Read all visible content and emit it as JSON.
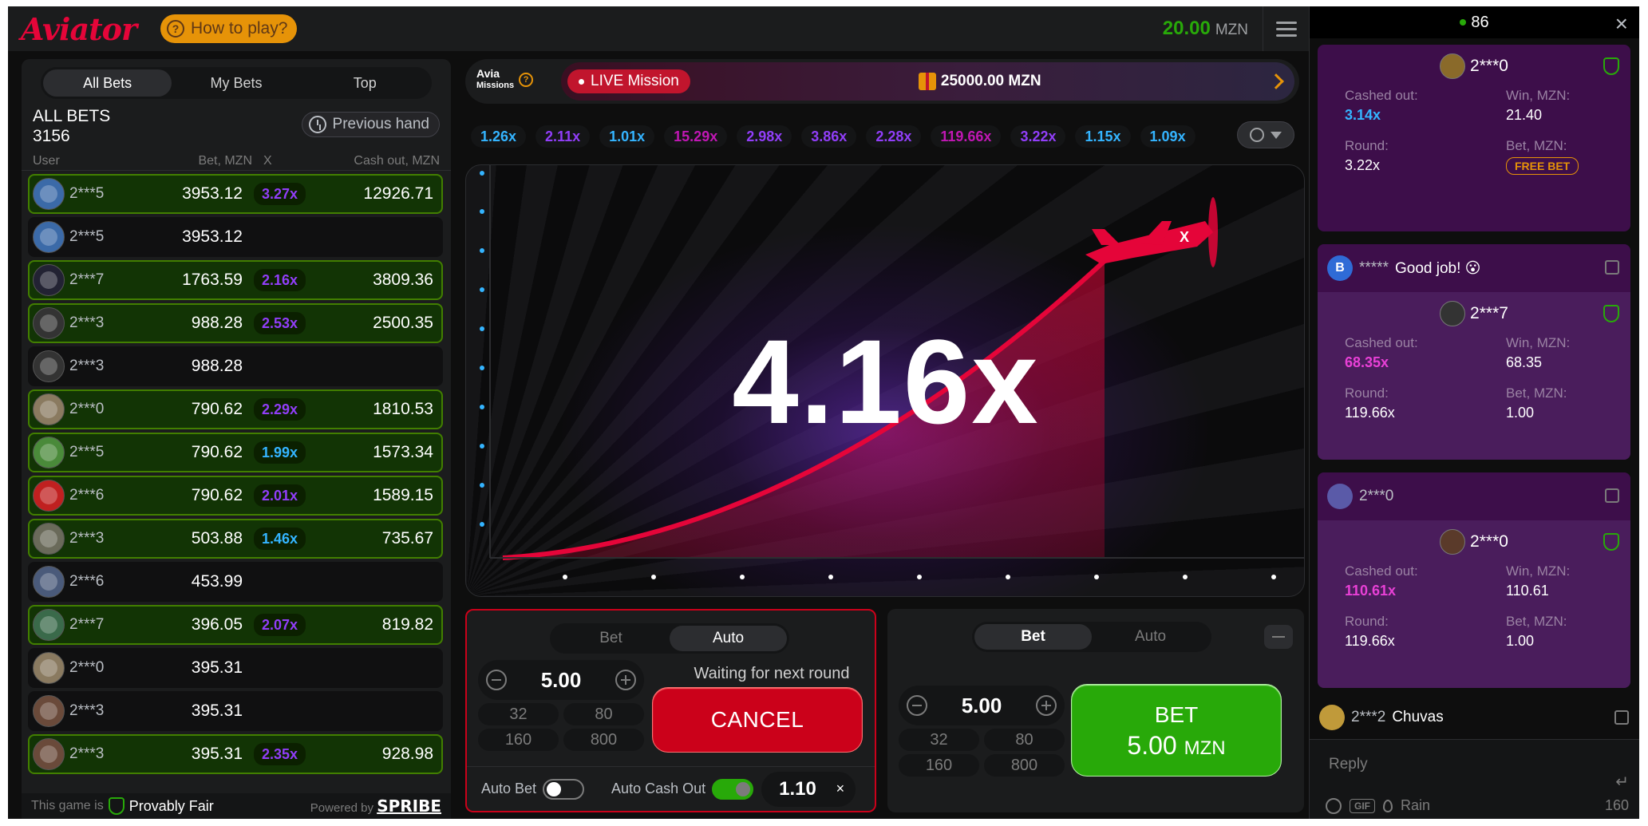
{
  "header": {
    "logo": "Aviator",
    "how_to_play": "How to play?",
    "balance": "20.00",
    "currency": "MZN"
  },
  "bets_panel": {
    "tabs": [
      "All Bets",
      "My Bets",
      "Top"
    ],
    "active_tab": "All Bets",
    "title": "ALL BETS",
    "count": "3156",
    "previous_hand": "Previous hand",
    "columns": {
      "user": "User",
      "bet": "Bet, MZN",
      "x": "X",
      "cashout": "Cash out, MZN"
    },
    "rows": [
      {
        "user": "2***5",
        "bet": "3953.12",
        "mult": "3.27x",
        "cashout": "12926.71",
        "win": true,
        "mult_color": "#913ef8",
        "avatar": "#3b6aa8"
      },
      {
        "user": "2***5",
        "bet": "3953.12",
        "mult": "",
        "cashout": "",
        "win": false,
        "mult_color": "",
        "avatar": "#3b6aa8"
      },
      {
        "user": "2***7",
        "bet": "1763.59",
        "mult": "2.16x",
        "cashout": "3809.36",
        "win": true,
        "mult_color": "#913ef8",
        "avatar": "#222233"
      },
      {
        "user": "2***3",
        "bet": "988.28",
        "mult": "2.53x",
        "cashout": "2500.35",
        "win": true,
        "mult_color": "#913ef8",
        "avatar": "#333333"
      },
      {
        "user": "2***3",
        "bet": "988.28",
        "mult": "",
        "cashout": "",
        "win": false,
        "mult_color": "",
        "avatar": "#333333"
      },
      {
        "user": "2***0",
        "bet": "790.62",
        "mult": "2.29x",
        "cashout": "1810.53",
        "win": true,
        "mult_color": "#913ef8",
        "avatar": "#8a7a60"
      },
      {
        "user": "2***5",
        "bet": "790.62",
        "mult": "1.99x",
        "cashout": "1573.34",
        "win": true,
        "mult_color": "#34b4ff",
        "avatar": "#4a8a3a"
      },
      {
        "user": "2***6",
        "bet": "790.62",
        "mult": "2.01x",
        "cashout": "1589.15",
        "win": true,
        "mult_color": "#913ef8",
        "avatar": "#c02020"
      },
      {
        "user": "2***3",
        "bet": "503.88",
        "mult": "1.46x",
        "cashout": "735.67",
        "win": true,
        "mult_color": "#34b4ff",
        "avatar": "#6a6a5a"
      },
      {
        "user": "2***6",
        "bet": "453.99",
        "mult": "",
        "cashout": "",
        "win": false,
        "mult_color": "",
        "avatar": "#4a5a7a"
      },
      {
        "user": "2***7",
        "bet": "396.05",
        "mult": "2.07x",
        "cashout": "819.82",
        "win": true,
        "mult_color": "#913ef8",
        "avatar": "#3a6a4a"
      },
      {
        "user": "2***0",
        "bet": "395.31",
        "mult": "",
        "cashout": "",
        "win": false,
        "mult_color": "",
        "avatar": "#8a7a60"
      },
      {
        "user": "2***3",
        "bet": "395.31",
        "mult": "",
        "cashout": "",
        "win": false,
        "mult_color": "",
        "avatar": "#6a4a3a"
      },
      {
        "user": "2***3",
        "bet": "395.31",
        "mult": "2.35x",
        "cashout": "928.98",
        "win": true,
        "mult_color": "#913ef8",
        "avatar": "#6a4a3a"
      }
    ],
    "footer": {
      "fair_prefix": "This game is",
      "fair_label": "Provably Fair",
      "powered": "Powered by",
      "brand": "SPRIBE"
    }
  },
  "missions": {
    "logo_line1": "Avia",
    "logo_line2": "Missions",
    "live_label": "LIVE Mission",
    "prize": "25000.00 MZN"
  },
  "history": [
    {
      "v": "1.26x",
      "c": "#34b4ff"
    },
    {
      "v": "2.11x",
      "c": "#913ef8"
    },
    {
      "v": "1.01x",
      "c": "#34b4ff"
    },
    {
      "v": "15.29x",
      "c": "#c017b4"
    },
    {
      "v": "2.98x",
      "c": "#913ef8"
    },
    {
      "v": "3.86x",
      "c": "#913ef8"
    },
    {
      "v": "2.28x",
      "c": "#913ef8"
    },
    {
      "v": "119.66x",
      "c": "#c017b4"
    },
    {
      "v": "3.22x",
      "c": "#913ef8"
    },
    {
      "v": "1.15x",
      "c": "#34b4ff"
    },
    {
      "v": "1.09x",
      "c": "#34b4ff"
    }
  ],
  "game": {
    "multiplier": "4.16x",
    "curve_color": "#e50539"
  },
  "bet_left": {
    "tabs": [
      "Bet",
      "Auto"
    ],
    "active": "Auto",
    "amount": "5.00",
    "quick": [
      "32",
      "80",
      "160",
      "800"
    ],
    "waiting": "Waiting for next round",
    "cancel": "CANCEL",
    "auto_bet": "Auto Bet",
    "auto_cashout": "Auto Cash Out",
    "auto_cashout_value": "1.10",
    "clear": "×"
  },
  "bet_right": {
    "tabs": [
      "Bet",
      "Auto"
    ],
    "active": "Bet",
    "amount": "5.00",
    "quick": [
      "32",
      "80",
      "160",
      "800"
    ],
    "bet_label": "BET",
    "bet_amount": "5.00",
    "bet_currency": "MZN"
  },
  "chat": {
    "online": "86",
    "close": "×",
    "cards": [
      {
        "user": "2***0",
        "cashed_label": "Cashed out:",
        "cashed": "3.14x",
        "cashed_color": "#34b4ff",
        "win_label": "Win, MZN:",
        "win": "21.40",
        "round_label": "Round:",
        "round": "3.22x",
        "bet_label": "Bet, MZN:",
        "bet": "",
        "free_bet": "FREE BET"
      },
      {
        "user": "2***7",
        "cashed_label": "Cashed out:",
        "cashed": "68.35x",
        "cashed_color": "#e840d6",
        "win_label": "Win, MZN:",
        "win": "68.35",
        "round_label": "Round:",
        "round": "119.66x",
        "bet_label": "Bet, MZN:",
        "bet": "1.00",
        "free_bet": ""
      },
      {
        "user": "2***0",
        "cashed_label": "Cashed out:",
        "cashed": "110.61x",
        "cashed_color": "#e840d6",
        "win_label": "Win, MZN:",
        "win": "110.61",
        "round_label": "Round:",
        "round": "119.66x",
        "bet_label": "Bet, MZN:",
        "bet": "1.00",
        "free_bet": ""
      }
    ],
    "messages": [
      {
        "user": "*****",
        "text": "Good job! 😮",
        "initial": "B"
      },
      {
        "user": "2***0",
        "text": ""
      },
      {
        "user": "2***2",
        "text": "Chuvas"
      }
    ],
    "reply_placeholder": "Reply",
    "gif": "GIF",
    "rain": "Rain",
    "char_count": "160"
  }
}
